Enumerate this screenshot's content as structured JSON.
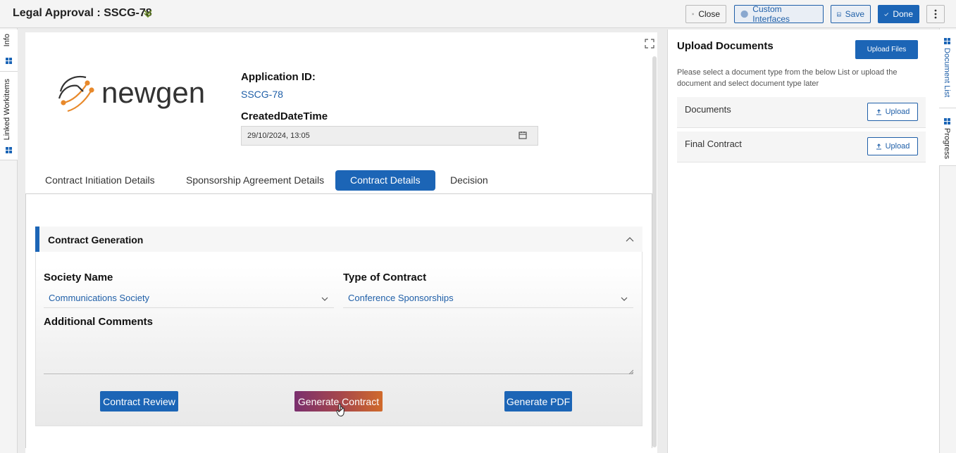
{
  "header": {
    "title": "Legal Approval : SSCG-78",
    "buttons": {
      "close": "Close",
      "custom_interfaces": "Custom Interfaces",
      "save": "Save",
      "done": "Done"
    }
  },
  "left_tabs": [
    "Info",
    "Linked Workitems"
  ],
  "right_tabs": [
    "Document List",
    "Progress"
  ],
  "form": {
    "logo_text": "newgen",
    "application_id_label": "Application ID:",
    "application_id_value": "SSCG-78",
    "created_label": "CreatedDateTime",
    "created_value": "29/10/2024, 13:05",
    "tabs": [
      {
        "label": "Contract Initiation Details",
        "active": false
      },
      {
        "label": "Sponsorship Agreement Details",
        "active": false
      },
      {
        "label": "Contract Details",
        "active": true
      },
      {
        "label": "Decision",
        "active": false
      }
    ],
    "section_title": "Contract Generation",
    "society_label": "Society Name",
    "society_value": "Communications Society",
    "contract_type_label": "Type of Contract",
    "contract_type_value": "Conference Sponsorships",
    "comments_label": "Additional Comments",
    "comments_value": "",
    "buttons": {
      "review": "Contract Review",
      "generate": "Generate Contract",
      "pdf": "Generate PDF"
    }
  },
  "documents": {
    "title": "Upload Documents",
    "upload_files_label": "Upload Files",
    "description": "Please select a document type from the below List or upload the document and select document type later",
    "rows": [
      {
        "label": "Documents",
        "button": "Upload"
      },
      {
        "label": "Final Contract",
        "button": "Upload"
      }
    ]
  },
  "colors": {
    "primary": "#1c65b6",
    "link": "#1f5fa8",
    "logo_orange": "#e8892b",
    "logo_dark": "#333333"
  }
}
